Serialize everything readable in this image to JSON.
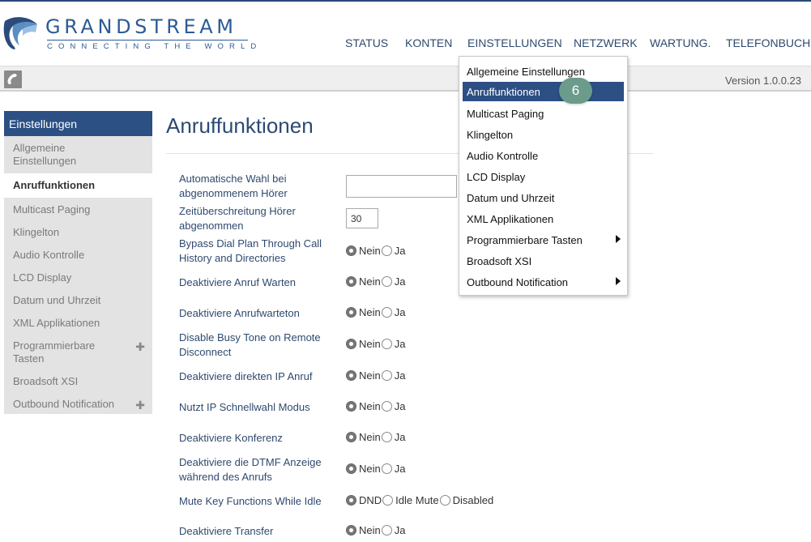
{
  "brand": {
    "name": "GRANDSTREAM",
    "tagline": "CONNECTING THE WORLD"
  },
  "topnav": [
    "STATUS",
    "KONTEN",
    "EINSTELLUNGEN",
    "NETZWERK",
    "WARTUNG.",
    "TELEFONBUCH"
  ],
  "version": "Version 1.0.0.23",
  "sidebar": {
    "title": "Einstellungen",
    "items": [
      "Allgemeine Einstellungen",
      "Anruffunktionen",
      "Multicast Paging",
      "Klingelton",
      "Audio Kontrolle",
      "LCD Display",
      "Datum und Uhrzeit",
      "XML Applikationen",
      "Programmierbare Tasten",
      "Broadsoft XSI",
      "Outbound Notification"
    ],
    "active_index": 1
  },
  "page": {
    "title": "Anruffunktionen"
  },
  "options": {
    "no": "Nein",
    "yes": "Ja",
    "dnd": "DND",
    "idle_mute": "Idle Mute",
    "disabled": "Disabled"
  },
  "fields": {
    "auto_dial_label": "Automatische Wahl bei abgenommenem Hörer",
    "auto_dial_value": "",
    "offhook_timeout_label": "Zeitüberschreitung Hörer abgenommen",
    "offhook_timeout_value": "30",
    "bypass_label": "Bypass Dial Plan Through Call History and Directories",
    "call_waiting_label": "Deaktiviere Anruf Warten",
    "call_waiting_tone_label": "Deaktiviere Anrufwarteton",
    "busy_tone_label": "Disable Busy Tone on Remote Disconnect",
    "direct_ip_label": "Deaktiviere direkten IP Anruf",
    "ip_speed_dial_label": "Nutzt IP Schnellwahl Modus",
    "conference_label": "Deaktiviere Konferenz",
    "dtmf_label": "Deaktiviere die DTMF Anzeige während des Anrufs",
    "mute_key_label": "Mute Key Functions While Idle",
    "transfer_label": "Deaktiviere Transfer"
  },
  "dropdown": {
    "items": [
      "Allgemeine Einstellungen",
      "Anruffunktionen",
      "Multicast Paging",
      "Klingelton",
      "Audio Kontrolle",
      "LCD Display",
      "Datum und Uhrzeit",
      "XML Applikationen",
      "Programmierbare Tasten",
      "Broadsoft XSI",
      "Outbound Notification"
    ],
    "highlighted_index": 1
  },
  "step_badge": "6",
  "colors": {
    "brand_blue": "#2c4f84",
    "link_blue": "#2f4a6e",
    "badge": "#6b9b8a"
  }
}
